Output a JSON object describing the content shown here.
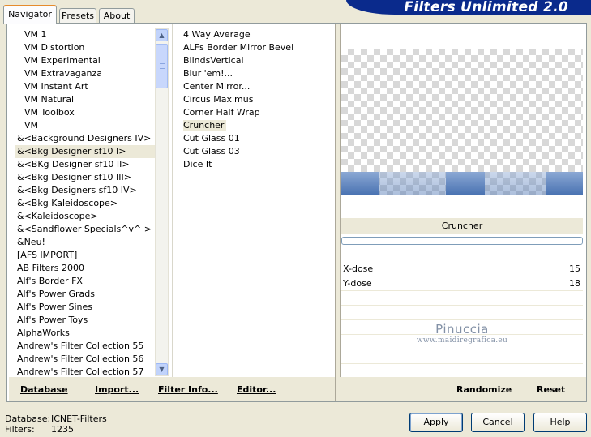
{
  "tabs": [
    {
      "label": "Navigator",
      "active": true
    },
    {
      "label": "Presets",
      "active": false
    },
    {
      "label": "About",
      "active": false
    }
  ],
  "header": {
    "title": "Filters Unlimited 2.0"
  },
  "categories": [
    "VM 1",
    "VM Distortion",
    "VM Experimental",
    "VM Extravaganza",
    "VM Instant Art",
    "VM Natural",
    "VM Toolbox",
    "VM",
    "&<Background Designers IV>",
    "&<Bkg Designer sf10 I>",
    "&<BKg Designer sf10 II>",
    "&<Bkg Designer sf10 III>",
    "&<Bkg Designers sf10 IV>",
    "&<Bkg Kaleidoscope>",
    "&<Kaleidoscope>",
    "&<Sandflower Specials^v^ >",
    "&Neu!",
    "[AFS IMPORT]",
    "AB Filters 2000",
    "Alf's Border FX",
    "Alf's Power Grads",
    "Alf's Power Sines",
    "Alf's Power Toys",
    "AlphaWorks",
    "Andrew's Filter Collection 55",
    "Andrew's Filter Collection 56",
    "Andrew's Filter Collection 57"
  ],
  "selected_category_index": 9,
  "filters": [
    "4 Way Average",
    "ALFs Border Mirror Bevel",
    "BlindsVertical",
    "Blur 'em!...",
    "Center Mirror...",
    "Circus Maximus",
    "Corner Half Wrap",
    "Cruncher",
    "Cut Glass 01",
    "Cut Glass 03",
    "Dice It"
  ],
  "selected_filter_index": 7,
  "filter_display": {
    "name": "Cruncher"
  },
  "params": [
    {
      "label": "X-dose",
      "value": "15"
    },
    {
      "label": "Y-dose",
      "value": "18"
    },
    {
      "label": "",
      "value": ""
    },
    {
      "label": "",
      "value": ""
    },
    {
      "label": "",
      "value": ""
    },
    {
      "label": "",
      "value": ""
    },
    {
      "label": "",
      "value": ""
    },
    {
      "label": "",
      "value": ""
    }
  ],
  "watermark": {
    "line1": "Pinuccia",
    "line2": "www.maidiregrafica.eu"
  },
  "toolbar": {
    "database": "Database",
    "import": "Import...",
    "filter_info": "Filter Info...",
    "editor": "Editor..."
  },
  "right_toolbar": {
    "randomize": "Randomize",
    "reset": "Reset"
  },
  "status": {
    "database_label": "Database:",
    "database_value": "ICNET-Filters",
    "filters_label": "Filters:",
    "filters_value": "1235"
  },
  "buttons": {
    "apply": "Apply",
    "cancel": "Cancel",
    "help": "Help"
  },
  "colors": {
    "header_bg": "#0a2a8c",
    "active_tab_accent": "#e68b2c",
    "preview_band": "#4a73b2"
  },
  "icons": {
    "scroll_up": "scroll-up-arrow-icon",
    "scroll_down": "scroll-down-arrow-icon"
  }
}
